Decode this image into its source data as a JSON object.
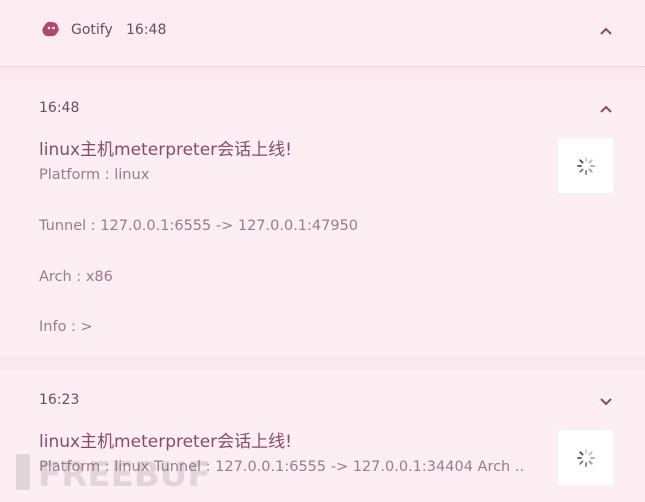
{
  "header": {
    "app_name": "Gotify",
    "time": "16:48",
    "icon": "gotify-logo-icon",
    "collapse_icon": "chevron-up-icon"
  },
  "notifications": [
    {
      "time": "16:48",
      "title": "linux主机meterpreter会话上线!",
      "lines": [
        "Platform : linux",
        "Tunnel : 127.0.0.1:6555 -> 127.0.0.1:47950",
        "Arch : x86",
        "Info : >"
      ],
      "toggle_icon": "chevron-up-icon",
      "thumbnail_icon": "loading-spinner-icon"
    },
    {
      "time": "16:23",
      "title": "linux主机meterpreter会话上线!",
      "lines": [
        "Platform : linux  Tunnel : 127.0.0.1:6555 -> 127.0.0.1:34404  Arch .."
      ],
      "toggle_icon": "chevron-down-icon",
      "thumbnail_icon": "loading-spinner-icon"
    }
  ],
  "watermark": "FREEBUF",
  "colors": {
    "background": "#fbe7ee",
    "card": "#fdeef3",
    "title": "#874b68",
    "text": "#9c7a89",
    "accent": "#b0486e"
  }
}
